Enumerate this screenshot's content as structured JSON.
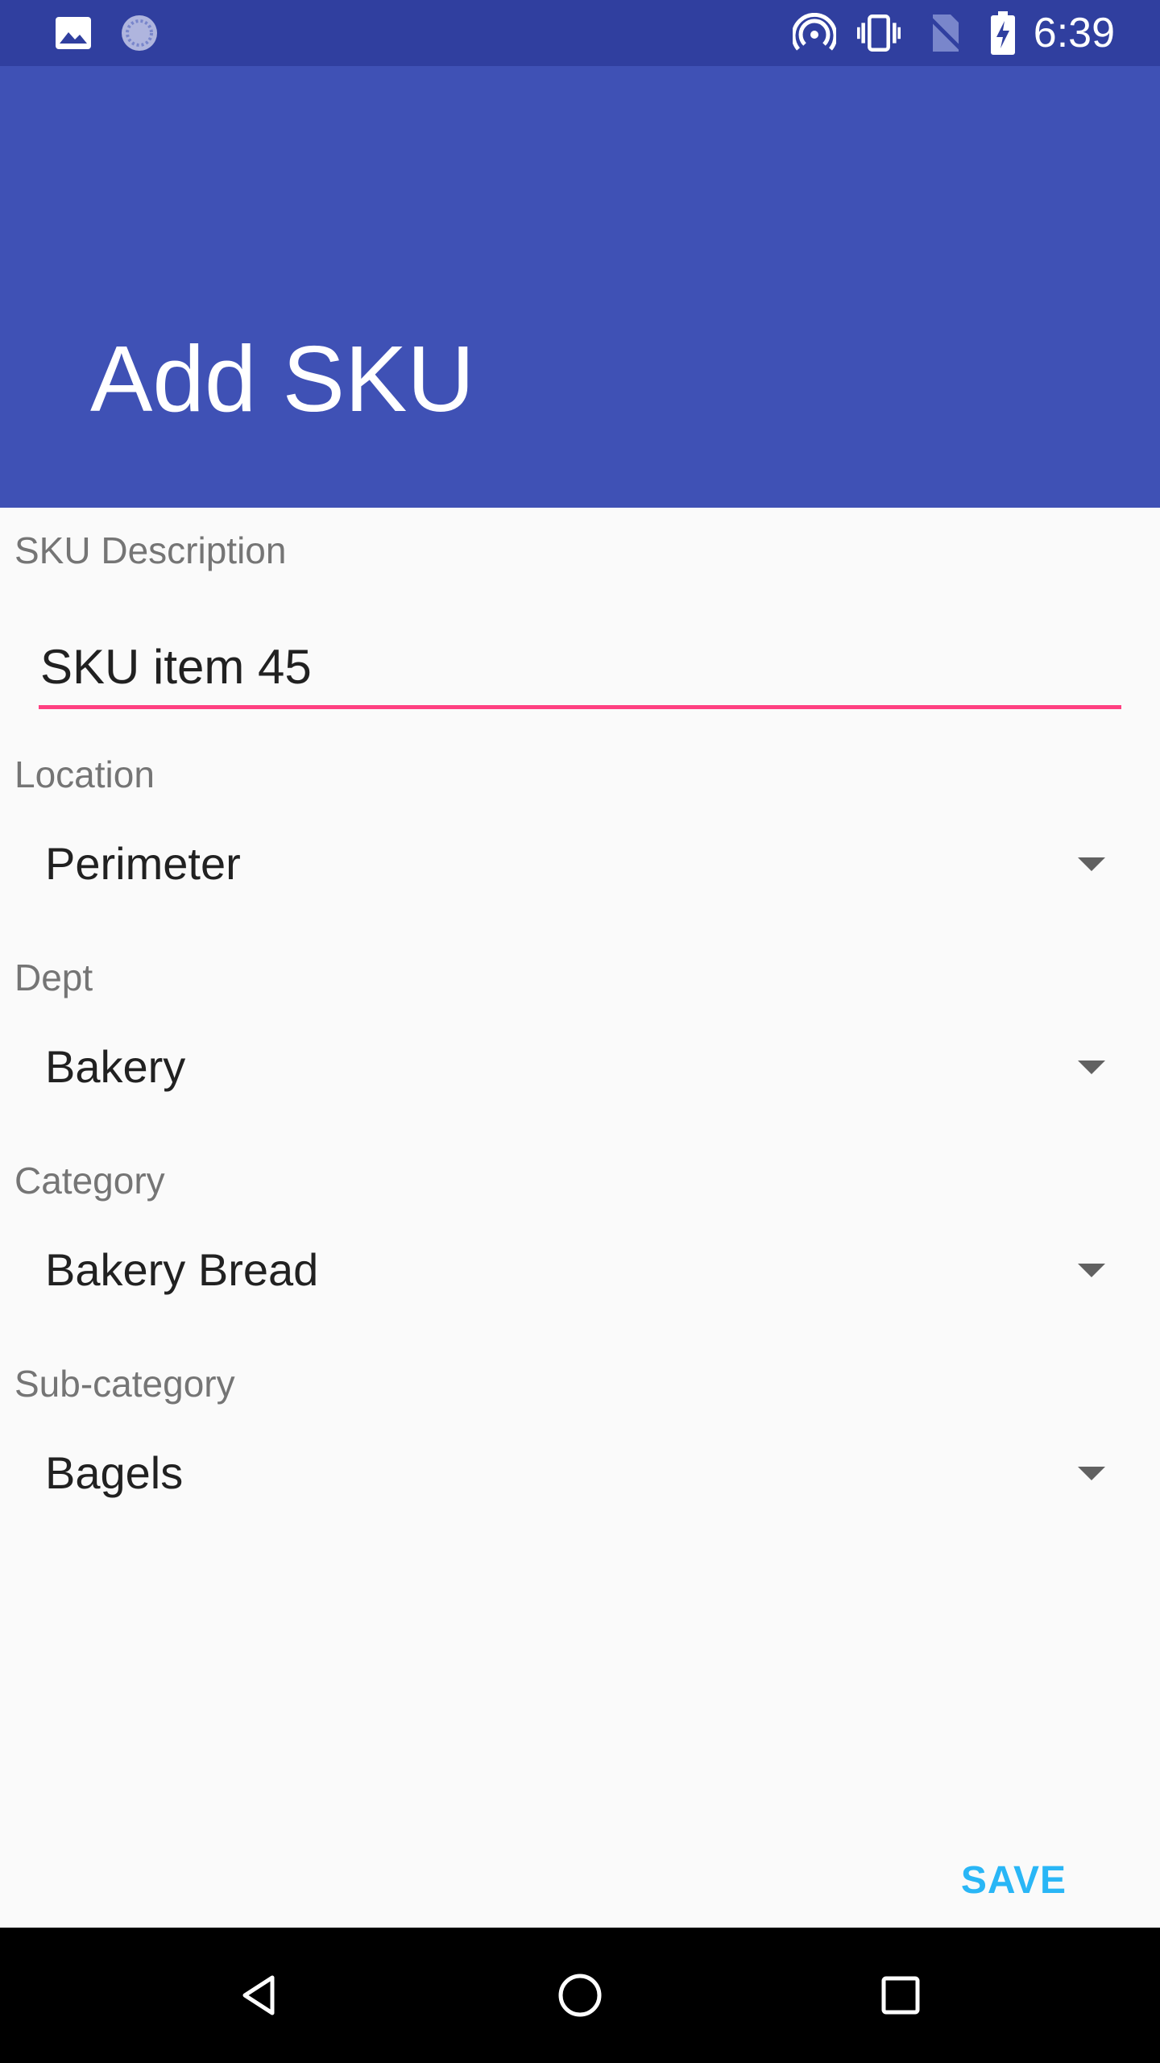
{
  "status_bar": {
    "time": "6:39",
    "icons": [
      "image-icon",
      "sync-icon",
      "hotspot-icon",
      "vibrate-icon",
      "no-sim-icon",
      "battery-charging-icon"
    ]
  },
  "app_bar": {
    "title": "Add SKU"
  },
  "form": {
    "description": {
      "label": "SKU Description",
      "value": "SKU item 45"
    },
    "location": {
      "label": "Location",
      "value": "Perimeter"
    },
    "dept": {
      "label": "Dept",
      "value": "Bakery"
    },
    "category": {
      "label": "Category",
      "value": "Bakery Bread"
    },
    "subcategory": {
      "label": "Sub-category",
      "value": "Bagels"
    }
  },
  "actions": {
    "save_label": "SAVE"
  },
  "nav_bar": {
    "icons": [
      "back-icon",
      "home-icon",
      "recents-icon"
    ]
  },
  "colors": {
    "primary": "#3f51b5",
    "primary_dark": "#303f9f",
    "accent": "#ff4081",
    "save_text": "#29b6f6"
  }
}
